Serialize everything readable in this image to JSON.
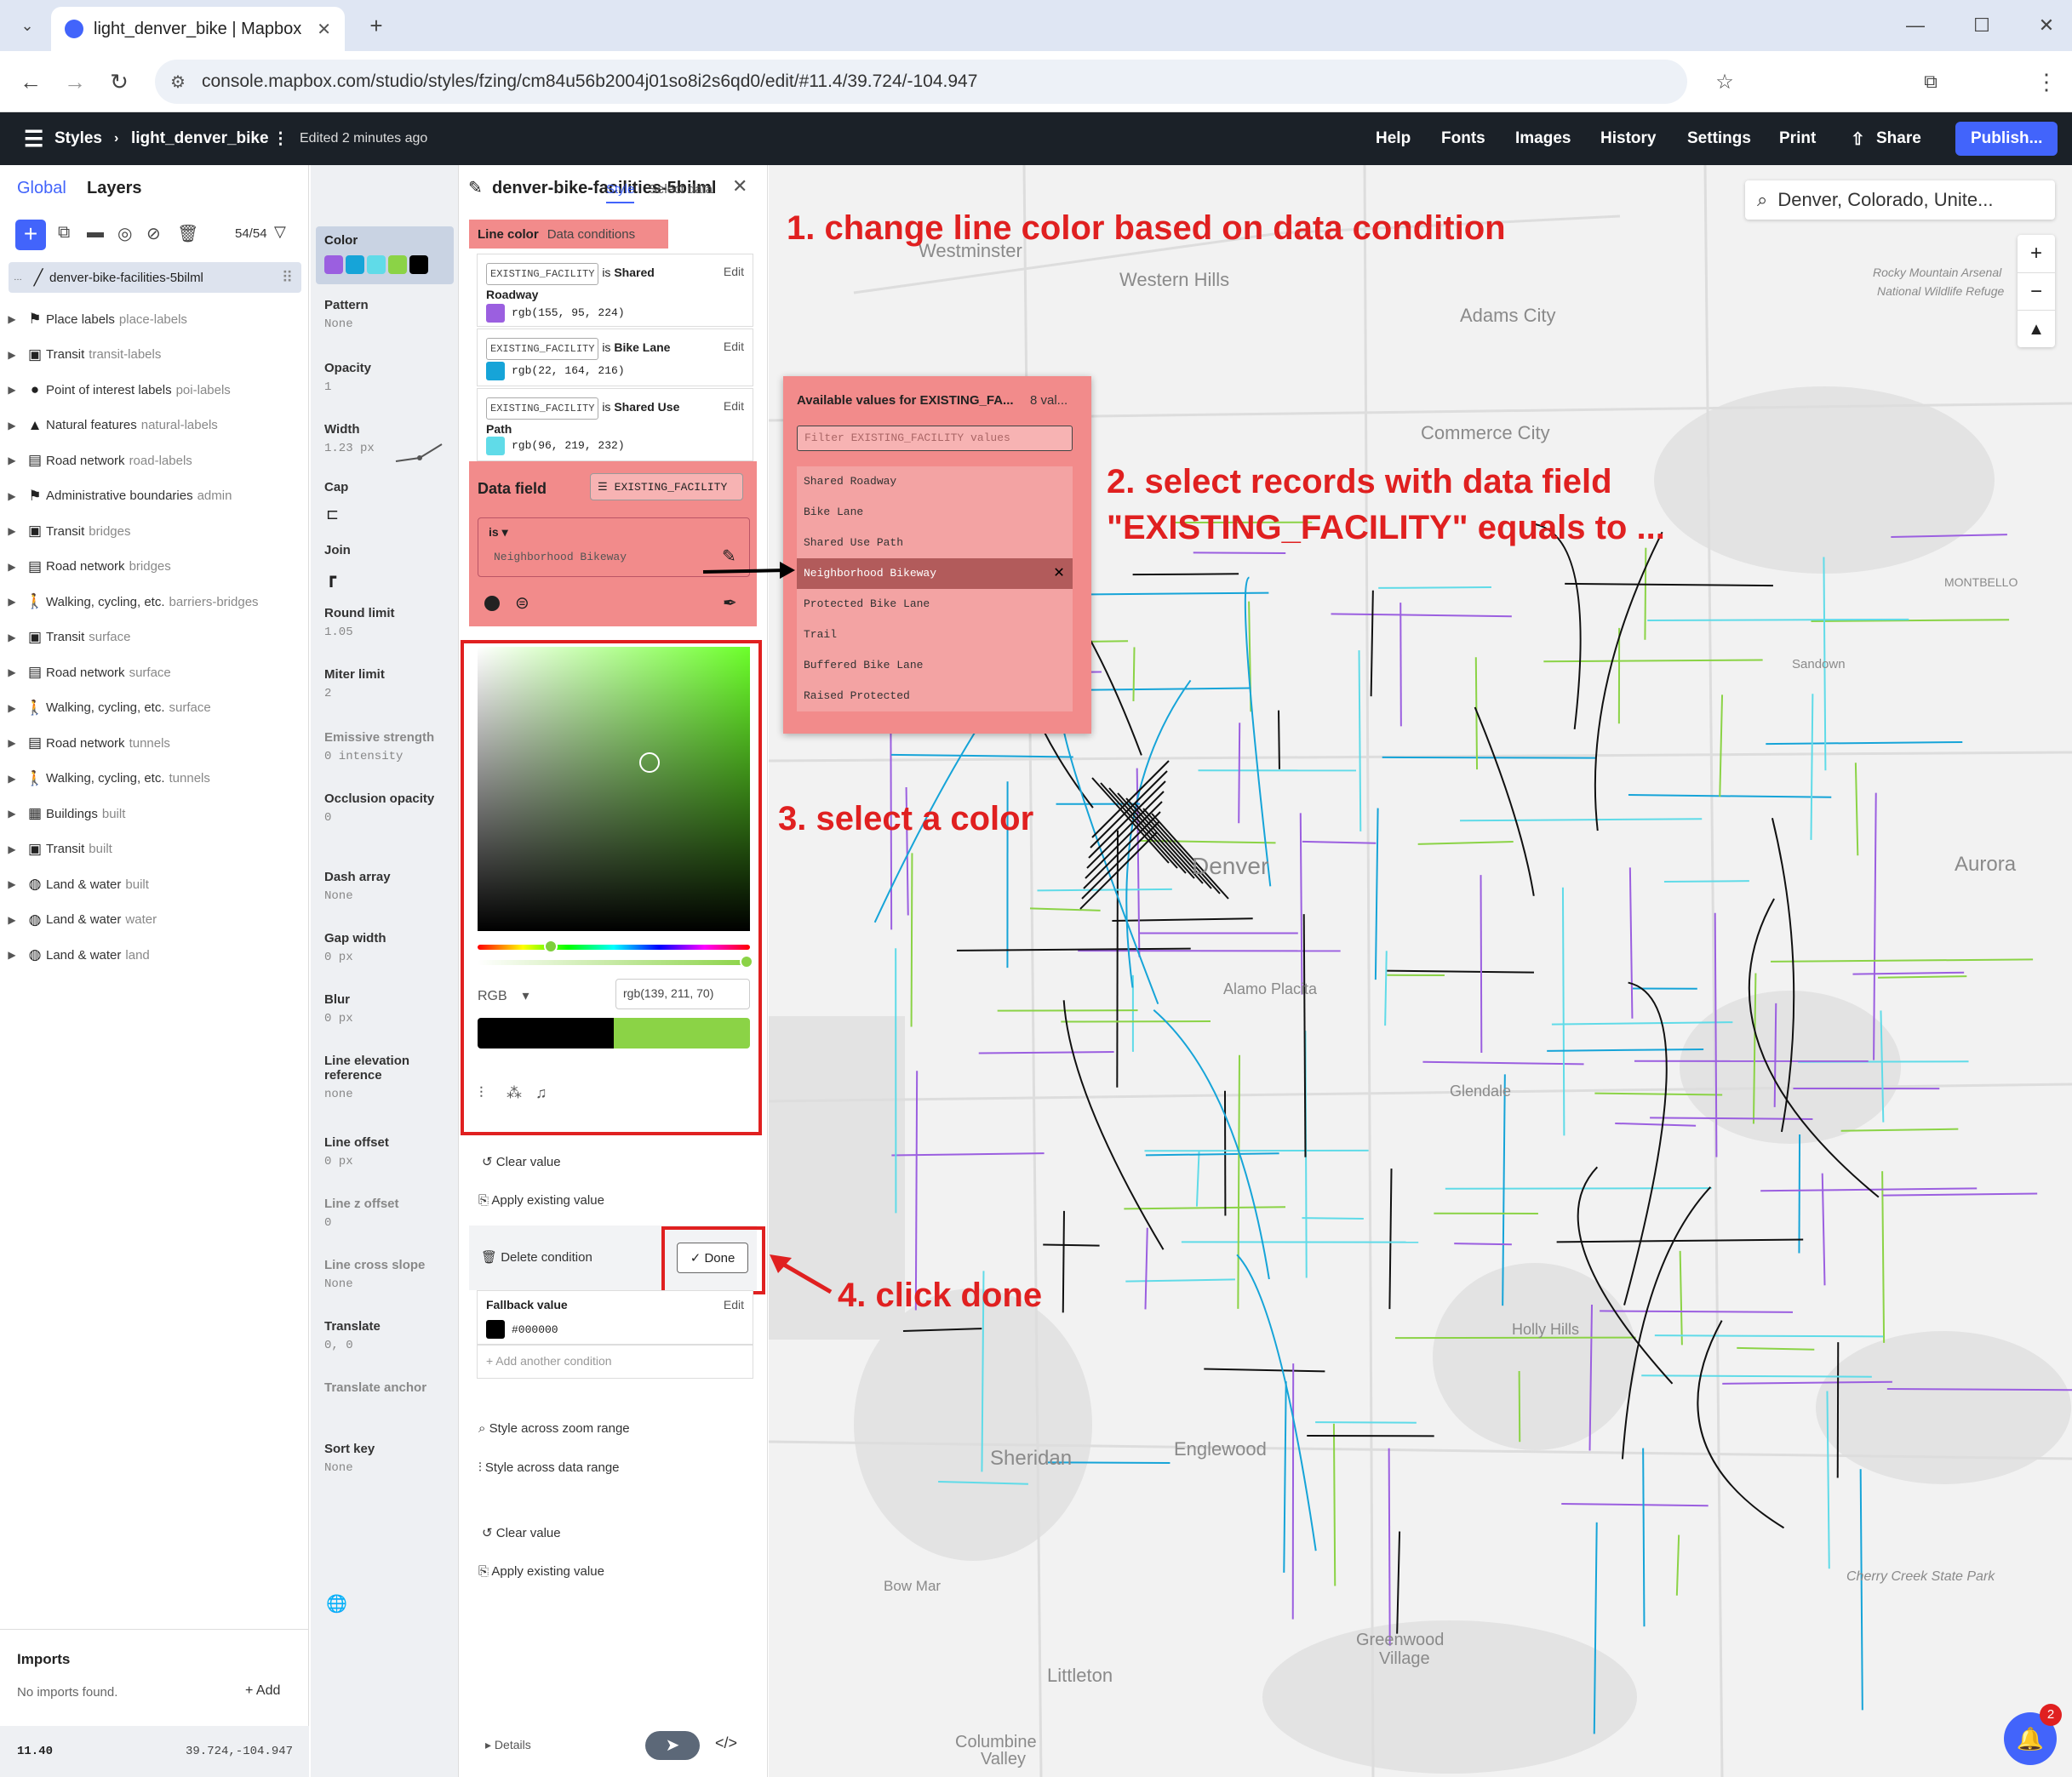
{
  "browser": {
    "tab_title": "light_denver_bike | Mapbox",
    "url": "console.mapbox.com/studio/styles/fzing/cm84u56b2004j01so8i2s6qd0/edit/#11.4/39.724/-104.947"
  },
  "header": {
    "styles": "Styles",
    "style_name": "light_denver_bike",
    "edited": "Edited 2 minutes ago",
    "menu": [
      "Help",
      "Fonts",
      "Images",
      "History",
      "Settings",
      "Print"
    ],
    "share": "Share",
    "publish": "Publish..."
  },
  "left_panel": {
    "tab_global": "Global",
    "tab_layers": "Layers",
    "layer_count": "54/54",
    "selected_layer": "denver-bike-facilities-5bilml",
    "layers": [
      {
        "label": "Place labels",
        "sub": "place-labels",
        "icon": "place-icon"
      },
      {
        "label": "Transit",
        "sub": "transit-labels",
        "icon": "transit-icon"
      },
      {
        "label": "Point of interest labels",
        "sub": "poi-labels",
        "icon": "pin-icon"
      },
      {
        "label": "Natural features",
        "sub": "natural-labels",
        "icon": "mountain-icon"
      },
      {
        "label": "Road network",
        "sub": "road-labels",
        "icon": "road-icon"
      },
      {
        "label": "Administrative boundaries",
        "sub": "admin",
        "icon": "flag-icon"
      },
      {
        "label": "Transit",
        "sub": "bridges",
        "icon": "transit-icon"
      },
      {
        "label": "Road network",
        "sub": "bridges",
        "icon": "road-icon"
      },
      {
        "label": "Walking, cycling, etc.",
        "sub": "barriers-bridges",
        "icon": "walk-icon"
      },
      {
        "label": "Transit",
        "sub": "surface",
        "icon": "transit-icon"
      },
      {
        "label": "Road network",
        "sub": "surface",
        "icon": "road-icon"
      },
      {
        "label": "Walking, cycling, etc.",
        "sub": "surface",
        "icon": "walk-icon"
      },
      {
        "label": "Road network",
        "sub": "tunnels",
        "icon": "road-icon"
      },
      {
        "label": "Walking, cycling, etc.",
        "sub": "tunnels",
        "icon": "walk-icon"
      },
      {
        "label": "Buildings",
        "sub": "built",
        "icon": "building-icon"
      },
      {
        "label": "Transit",
        "sub": "built",
        "icon": "transit-icon"
      },
      {
        "label": "Land & water",
        "sub": "built",
        "icon": "globe-icon"
      },
      {
        "label": "Land & water",
        "sub": "water",
        "icon": "globe-icon"
      },
      {
        "label": "Land & water",
        "sub": "land",
        "icon": "globe-icon"
      }
    ],
    "imports_title": "Imports",
    "no_imports": "No imports found.",
    "add": "Add",
    "zoom": "11.40",
    "coords": "39.724,-104.947"
  },
  "properties": {
    "color": "Color",
    "swatches": [
      "#9b5fe0",
      "#16a4d8",
      "#60dbe8",
      "#8bd346",
      "#000000"
    ],
    "items": [
      {
        "label": "Pattern",
        "value": "None"
      },
      {
        "label": "Opacity",
        "value": "1"
      },
      {
        "label": "Width",
        "value": "1.23 px"
      },
      {
        "label": "Cap",
        "value": ""
      },
      {
        "label": "Join",
        "value": ""
      },
      {
        "label": "Round limit",
        "value": "1.05"
      },
      {
        "label": "Miter limit",
        "value": "2"
      },
      {
        "label": "Emissive strength",
        "value": "0 intensity"
      },
      {
        "label": "Occlusion opacity",
        "value": "0"
      },
      {
        "label": "Dash array",
        "value": "None"
      },
      {
        "label": "Gap width",
        "value": "0 px"
      },
      {
        "label": "Blur",
        "value": "0 px"
      },
      {
        "label": "Line elevation reference",
        "value": "none"
      },
      {
        "label": "Line offset",
        "value": "0 px"
      },
      {
        "label": "Line z offset",
        "value": "0"
      },
      {
        "label": "Line cross slope",
        "value": "None"
      },
      {
        "label": "Translate",
        "value": "0, 0"
      },
      {
        "label": "Translate anchor",
        "value": ""
      },
      {
        "label": "Sort key",
        "value": "None"
      }
    ]
  },
  "editor": {
    "layer_title": "denver-bike-facilities-5bilml",
    "tab_style": "Style",
    "tab_select_data": "Select data",
    "line_color": "Line color",
    "data_conditions": "Data conditions",
    "conditions": [
      {
        "field": "EXISTING_FACILITY",
        "op": "is",
        "value": "Shared Roadway",
        "color_text": "rgb(155, 95, 224)",
        "color": "#9b5fe0",
        "edit": "Edit"
      },
      {
        "field": "EXISTING_FACILITY",
        "op": "is",
        "value": "Bike Lane",
        "color_text": "rgb(22, 164, 216)",
        "color": "#16a4d8",
        "edit": "Edit"
      },
      {
        "field": "EXISTING_FACILITY",
        "op": "is",
        "value": "Shared Use Path",
        "color_text": "rgb(96, 219, 232)",
        "color": "#60dbe8",
        "edit": "Edit"
      }
    ],
    "data_field_label": "Data field",
    "data_field_value": "EXISTING_FACILITY",
    "is_label": "is",
    "is_value": "Neighborhood Bikeway",
    "rgb_mode": "RGB",
    "rgb_value": "rgb(139, 211, 70)",
    "clear_value": "Clear value",
    "apply_existing": "Apply existing value",
    "delete_condition": "Delete condition",
    "done": "Done",
    "fallback_label": "Fallback value",
    "fallback_value": "#000000",
    "fallback_edit": "Edit",
    "add_condition": "Add another condition",
    "zoom_range": "Style across zoom range",
    "data_range": "Style across data range",
    "clear_value2": "Clear value",
    "apply_existing2": "Apply existing value",
    "details": "Details"
  },
  "dropdown": {
    "title": "Available values for EXISTING_FA...",
    "count": "8 val...",
    "placeholder": "Filter EXISTING_FACILITY values",
    "options": [
      "Shared Roadway",
      "Bike Lane",
      "Shared Use Path",
      "Neighborhood Bikeway",
      "Protected Bike Lane",
      "Trail",
      "Buffered Bike Lane",
      "Raised Protected"
    ]
  },
  "map": {
    "search": "Denver, Colorado, Unite...",
    "labels": [
      {
        "text": "Westminster"
      },
      {
        "text": "Western Hills"
      },
      {
        "text": "Adams City"
      },
      {
        "text": "Rocky Mountain Arsenal"
      },
      {
        "text": "National Wildlife Refuge"
      },
      {
        "text": "Commerce City"
      },
      {
        "text": "MONTBELLO"
      },
      {
        "text": "Sandown"
      },
      {
        "text": "Denver"
      },
      {
        "text": "Aurora"
      },
      {
        "text": "Alamo Placita"
      },
      {
        "text": "Glendale"
      },
      {
        "text": "Holly Hills"
      },
      {
        "text": "Sheridan"
      },
      {
        "text": "Englewood"
      },
      {
        "text": "Bow Mar"
      },
      {
        "text": "Cherry Creek State Park"
      },
      {
        "text": "Greenwood"
      },
      {
        "text": "Village"
      },
      {
        "text": "Littleton"
      },
      {
        "text": "Columbine"
      },
      {
        "text": "Valley"
      }
    ],
    "notif_count": "2"
  },
  "annotations": {
    "a1": "1. change line color based on data condition",
    "a2_line1": "2. select records with data field",
    "a2_line2": "\"EXISTING_FACILITY\" equals to ...",
    "a3": "3. select a color",
    "a4": "4. click done"
  }
}
